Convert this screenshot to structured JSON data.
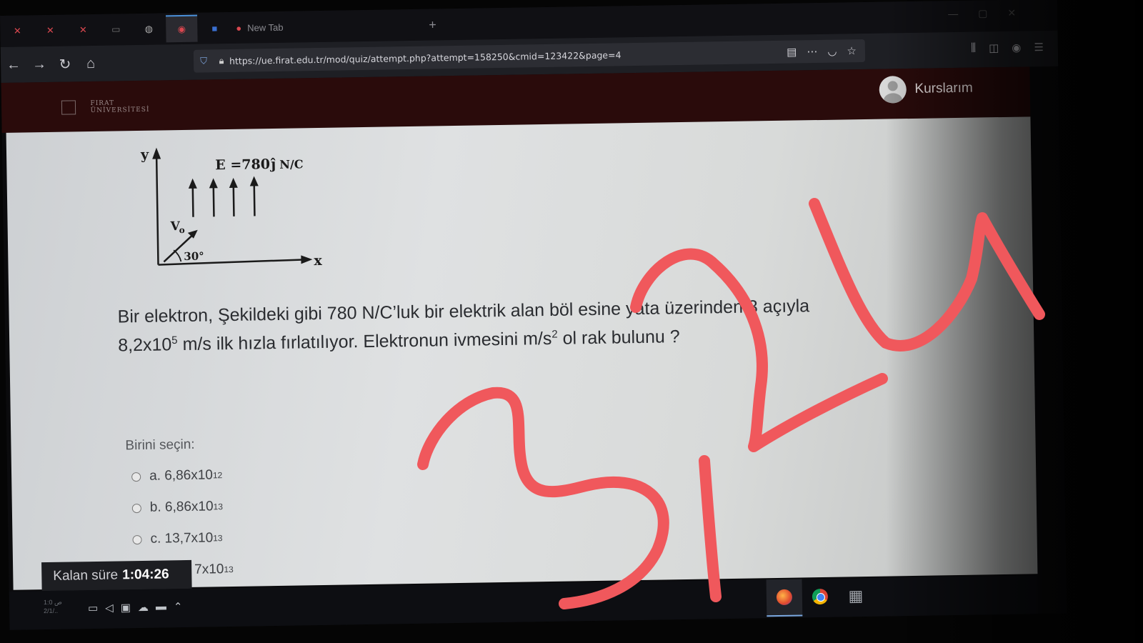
{
  "browser": {
    "tab_title": "New Tab",
    "url": "https://ue.firat.edu.tr/mod/quiz/attempt.php?attempt=158250&cmid=123422&page=4"
  },
  "site": {
    "user_menu_label": "Kurslarım"
  },
  "figure": {
    "y_label": "y",
    "x_label": "x",
    "field_label": "E =780",
    "field_unit": "N/C",
    "velocity_label": "V",
    "velocity_sub": "o",
    "angle_label": "30°"
  },
  "question": {
    "line1": "Bir elektron, Şekildeki gibi  780  N/C’luk bir elektrik alan böl  esine yata  üzerinden 3",
    "line1_end": " açıyla",
    "line2_a": "8,2x10",
    "line2_a_sup": "5",
    "line2_b": " m/s ilk hızla fırlatılıyor. Elektronun ivmesini m/s",
    "line2_b_sup": "2",
    "line2_c": " ol  rak bulunu  ?"
  },
  "answers": {
    "prompt": "Birini seçin:",
    "options": [
      {
        "label": "a. 6,86x10",
        "exp": "12"
      },
      {
        "label": "b. 6,86x10",
        "exp": "13"
      },
      {
        "label": "c. 13,7x10",
        "exp": "13"
      },
      {
        "label": "7x10",
        "exp": "13"
      }
    ]
  },
  "timer": {
    "label": "Kalan süre",
    "value": "1:04:26"
  },
  "annotation": {
    "handwritten_text": "3124",
    "color": "#f0585c"
  },
  "colors": {
    "site_header": "#2a0b0b",
    "content_bg": "#dfe1e2",
    "taskbar": "#0d0e12"
  }
}
